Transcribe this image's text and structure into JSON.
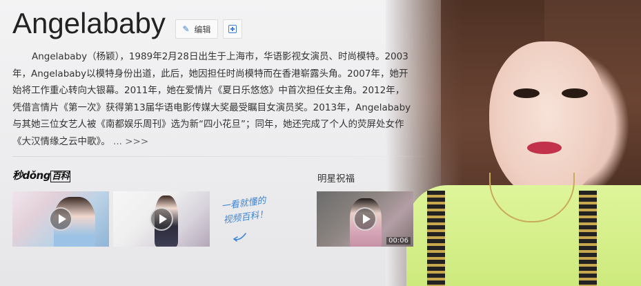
{
  "header": {
    "title": "Angelababy",
    "edit_label": "编辑"
  },
  "summary": {
    "text": "Angelababy（杨颖），1989年2月28日出生于上海市，华语影视女演员、时尚模特。2003年，Angelababy以模特身份出道，此后，她因担任时尚模特而在香港崭露头角。2007年，她开始将工作重心转向大银幕。2011年，她在爱情片《夏日乐悠悠》中首次担任女主角。2012年，凭借言情片《第一次》获得第13届华语电影传媒大奖最受瞩目女演员奖。2013年，Angelababy与其她三位女艺人被《南都娱乐周刊》选为新“四小花旦”；同年，她还完成了个人的荧屏处女作《大汉情缘之云中歌》。",
    "more_label": "... >>>"
  },
  "video_section": {
    "brand_part1": "秒dǒng",
    "brand_part2": "百科",
    "handwriting_line1": "一看就懂的",
    "handwriting_line2": "视频百科！"
  },
  "star_section": {
    "title": "明星祝福",
    "duration": "00:06"
  },
  "colors": {
    "accent": "#3a7fd5",
    "dress": "#d4ef86",
    "lips": "#c2324a"
  }
}
